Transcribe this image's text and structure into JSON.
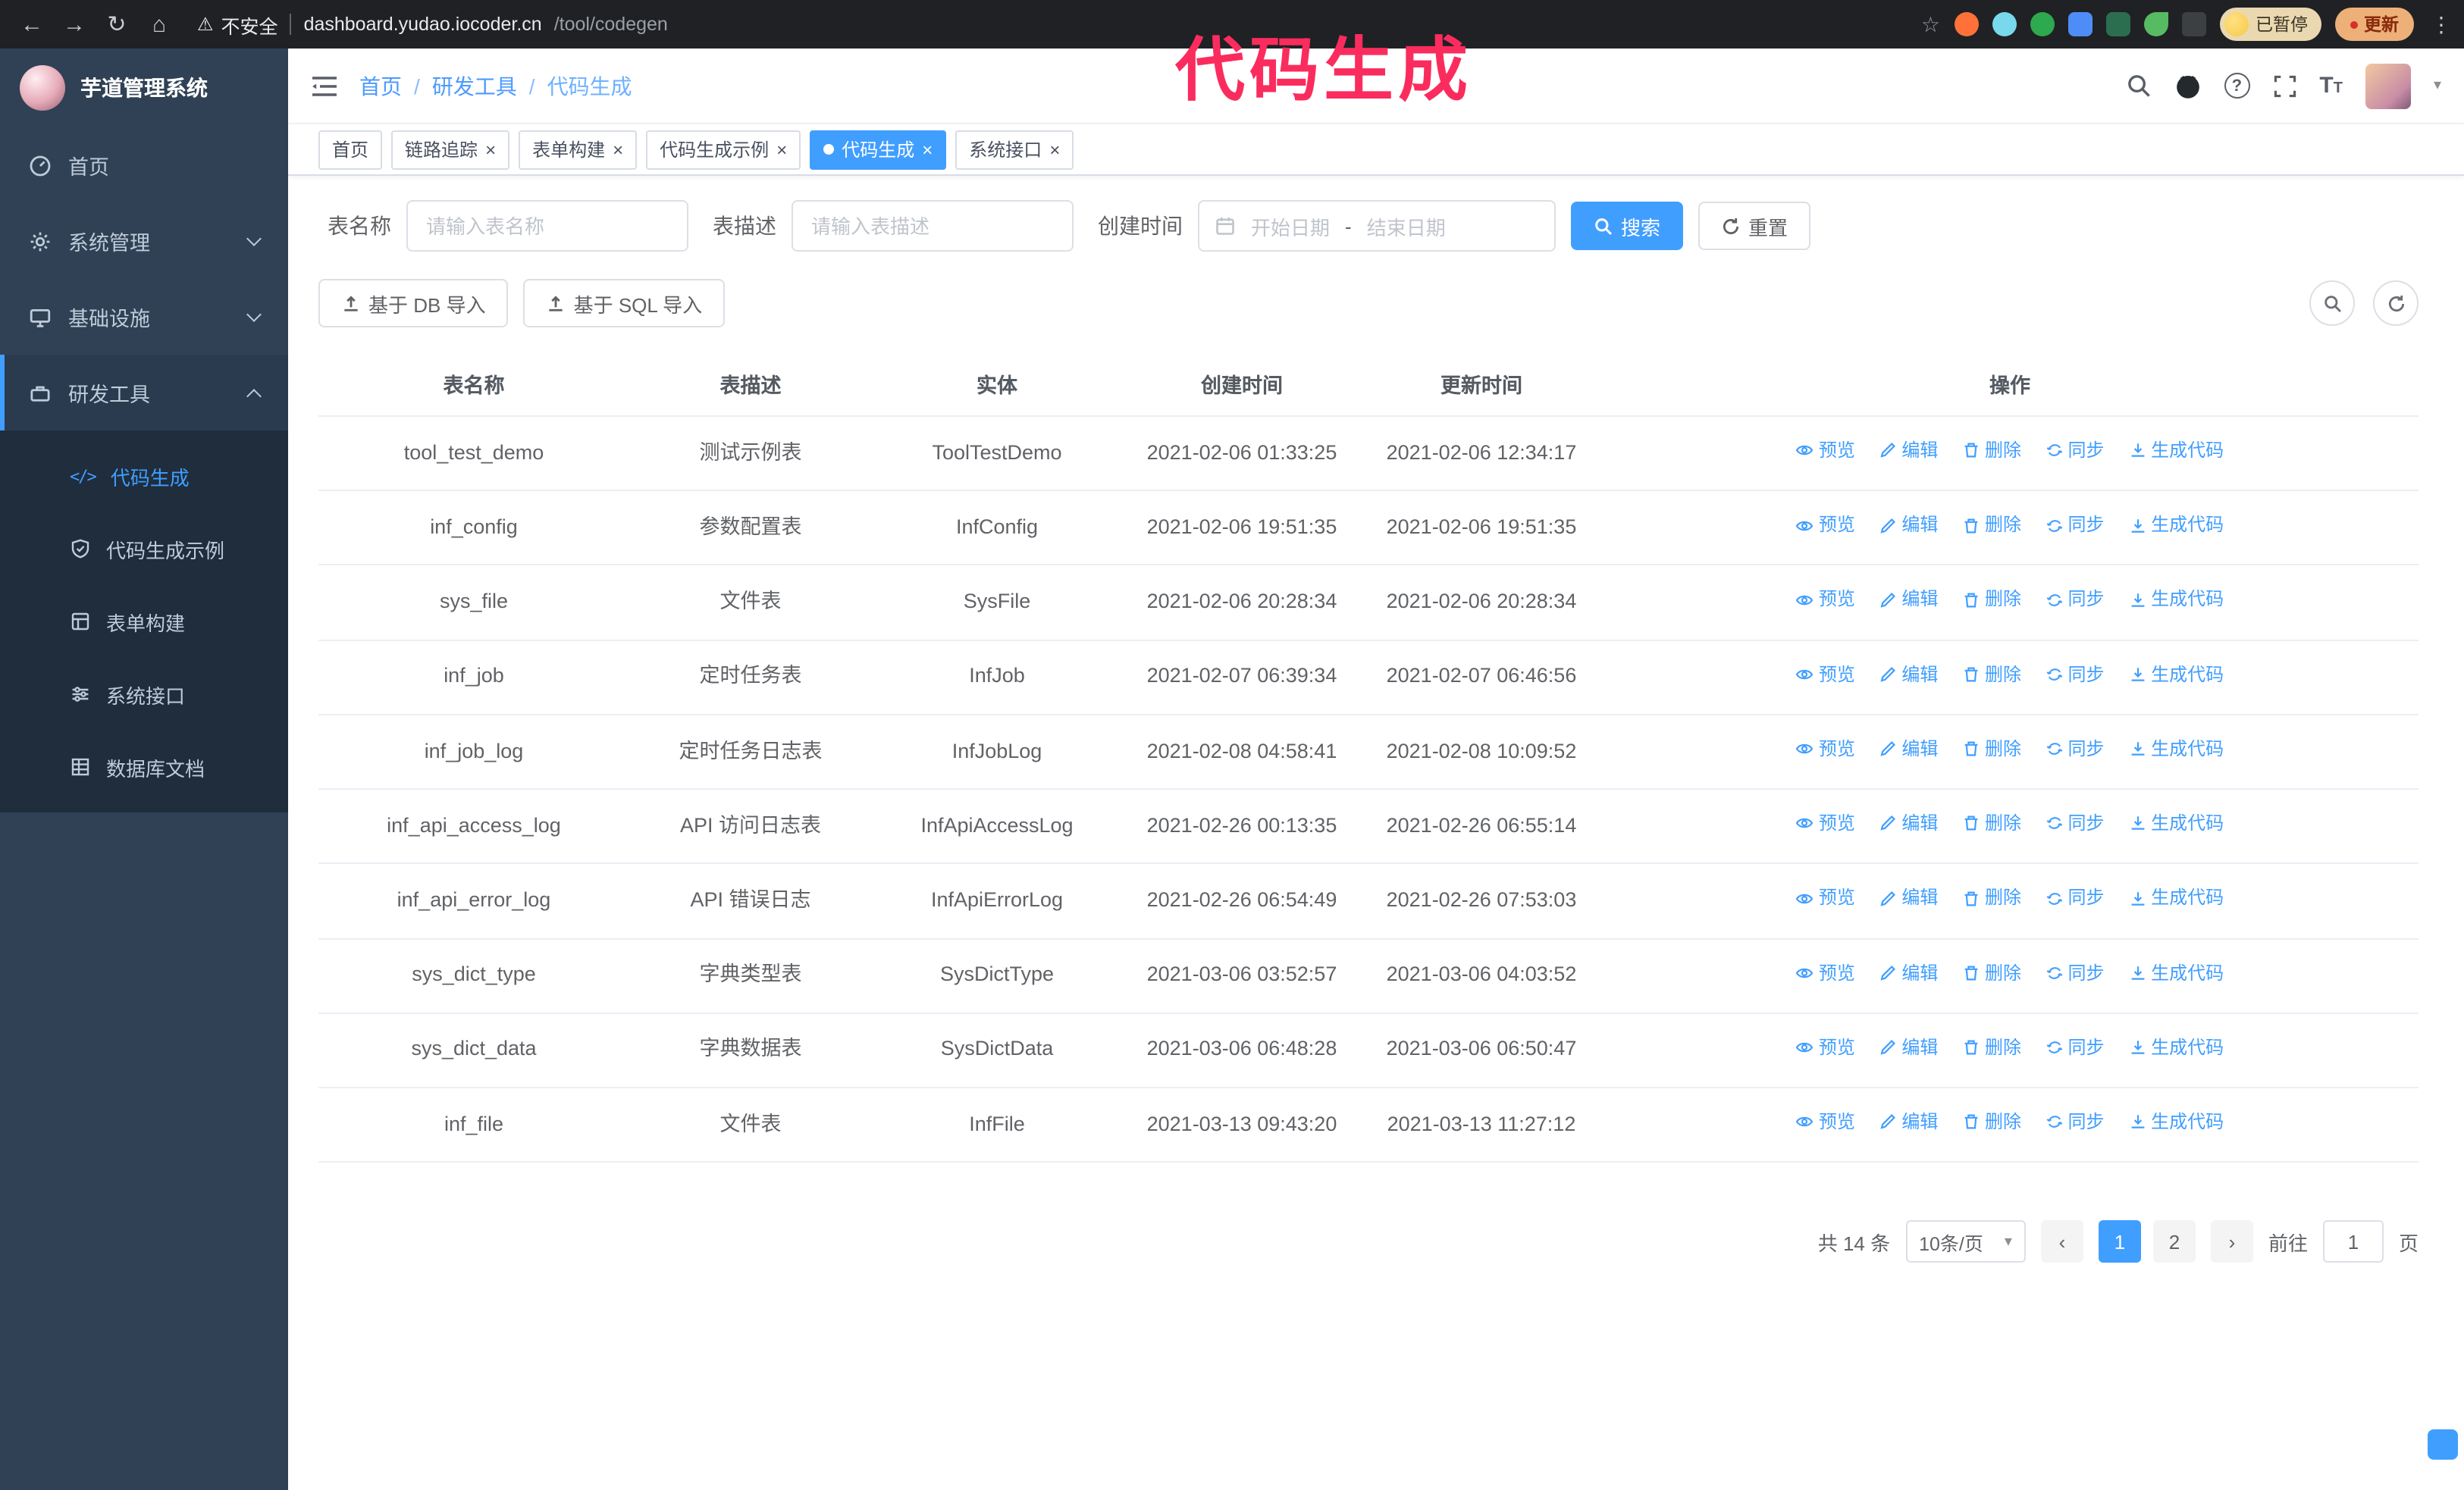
{
  "colors": {
    "accent": "#409eff",
    "annotation_pink": "#fa2c5e",
    "sidebar_bg": "#304156",
    "submenu_bg": "#1f2d3d",
    "chrome_bg": "#202124"
  },
  "glyphs": {
    "back": "←",
    "forward": "→",
    "reload": "↻",
    "home": "⌂",
    "warning": "⚠",
    "star": "☆",
    "more": "⋮",
    "close": "×",
    "caret": "▾",
    "prev": "‹",
    "next": "›",
    "code": "</>"
  },
  "chrome": {
    "security_text": "不安全",
    "url_host": "dashboard.yudao.iocoder.cn",
    "url_path": "/tool/codegen",
    "paused_badge": "已暂停",
    "update_button": "更新"
  },
  "annotation": {
    "text": "代码生成"
  },
  "sidebar": {
    "logo_title": "芋道管理系统",
    "items": [
      {
        "label": "首页"
      },
      {
        "label": "系统管理"
      },
      {
        "label": "基础设施"
      },
      {
        "label": "研发工具"
      }
    ],
    "submenu": [
      {
        "label": "代码生成",
        "active": true
      },
      {
        "label": "代码生成示例",
        "active": false
      },
      {
        "label": "表单构建",
        "active": false
      },
      {
        "label": "系统接口",
        "active": false
      },
      {
        "label": "数据库文档",
        "active": false
      }
    ]
  },
  "header": {
    "breadcrumb": [
      "首页",
      "研发工具",
      "代码生成"
    ],
    "separator": "/"
  },
  "tabs": [
    {
      "label": "首页",
      "closable": false,
      "active": false
    },
    {
      "label": "链路追踪",
      "closable": true,
      "active": false
    },
    {
      "label": "表单构建",
      "closable": true,
      "active": false
    },
    {
      "label": "代码生成示例",
      "closable": true,
      "active": false
    },
    {
      "label": "代码生成",
      "closable": true,
      "active": true
    },
    {
      "label": "系统接口",
      "closable": true,
      "active": false
    }
  ],
  "filters": {
    "table_name_label": "表名称",
    "table_name_placeholder": "请输入表名称",
    "table_desc_label": "表描述",
    "table_desc_placeholder": "请输入表描述",
    "create_time_label": "创建时间",
    "date_start_placeholder": "开始日期",
    "date_separator": "-",
    "date_end_placeholder": "结束日期",
    "search_button": "搜索",
    "reset_button": "重置"
  },
  "toolbar": {
    "import_db": "基于 DB 导入",
    "import_sql": "基于 SQL 导入"
  },
  "table": {
    "columns": [
      "表名称",
      "表描述",
      "实体",
      "创建时间",
      "更新时间",
      "操作"
    ],
    "actions": [
      "预览",
      "编辑",
      "删除",
      "同步",
      "生成代码"
    ],
    "rows": [
      {
        "name": "tool_test_demo",
        "desc": "测试示例表",
        "entity": "ToolTestDemo",
        "created": "2021-02-06 01:33:25",
        "updated": "2021-02-06 12:34:17"
      },
      {
        "name": "inf_config",
        "desc": "参数配置表",
        "entity": "InfConfig",
        "created": "2021-02-06 19:51:35",
        "updated": "2021-02-06 19:51:35"
      },
      {
        "name": "sys_file",
        "desc": "文件表",
        "entity": "SysFile",
        "created": "2021-02-06 20:28:34",
        "updated": "2021-02-06 20:28:34"
      },
      {
        "name": "inf_job",
        "desc": "定时任务表",
        "entity": "InfJob",
        "created": "2021-02-07 06:39:34",
        "updated": "2021-02-07 06:46:56"
      },
      {
        "name": "inf_job_log",
        "desc": "定时任务日志表",
        "entity": "InfJobLog",
        "created": "2021-02-08 04:58:41",
        "updated": "2021-02-08 10:09:52"
      },
      {
        "name": "inf_api_access_log",
        "desc": "API 访问日志表",
        "entity": "InfApiAccessLog",
        "created": "2021-02-26 00:13:35",
        "updated": "2021-02-26 06:55:14"
      },
      {
        "name": "inf_api_error_log",
        "desc": "API 错误日志",
        "entity": "InfApiErrorLog",
        "created": "2021-02-26 06:54:49",
        "updated": "2021-02-26 07:53:03"
      },
      {
        "name": "sys_dict_type",
        "desc": "字典类型表",
        "entity": "SysDictType",
        "created": "2021-03-06 03:52:57",
        "updated": "2021-03-06 04:03:52"
      },
      {
        "name": "sys_dict_data",
        "desc": "字典数据表",
        "entity": "SysDictData",
        "created": "2021-03-06 06:48:28",
        "updated": "2021-03-06 06:50:47"
      },
      {
        "name": "inf_file",
        "desc": "文件表",
        "entity": "InfFile",
        "created": "2021-03-13 09:43:20",
        "updated": "2021-03-13 11:27:12"
      }
    ]
  },
  "pagination": {
    "total": "共 14 条",
    "page_size": "10条/页",
    "pages": [
      {
        "label": "1",
        "active": true
      },
      {
        "label": "2",
        "active": false
      }
    ],
    "goto_label": "前往",
    "goto_value": "1",
    "page_unit": "页"
  }
}
